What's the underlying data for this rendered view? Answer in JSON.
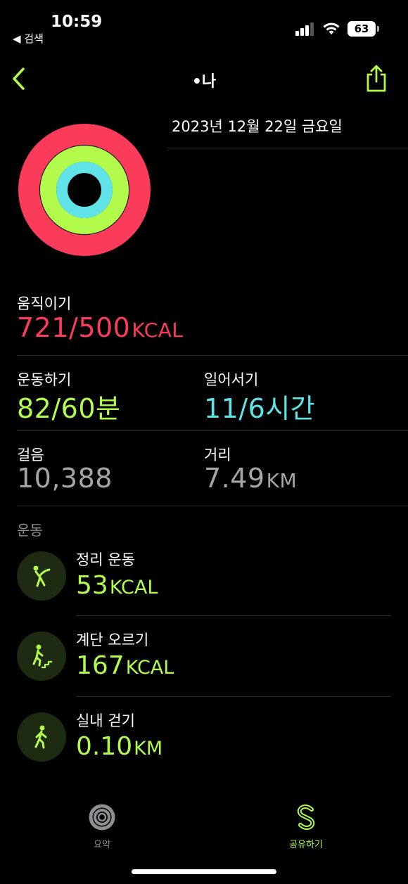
{
  "status_bar": {
    "time": "10:59",
    "back_app": "◀ 검색",
    "battery": "63"
  },
  "nav": {
    "title": "•나"
  },
  "summary": {
    "date": "2023년 12월 22일 금요일"
  },
  "rings": {
    "move_progress": 1.44,
    "exercise_progress": 1.37,
    "stand_progress": 1.83
  },
  "metrics": {
    "move": {
      "label": "움직이기",
      "value": "721/500",
      "unit": "KCAL"
    },
    "exercise": {
      "label": "운동하기",
      "value": "82/60분"
    },
    "stand": {
      "label": "일어서기",
      "value": "11/6시간"
    },
    "steps": {
      "label": "걸음",
      "value": "10,388"
    },
    "distance": {
      "label": "거리",
      "value": "7.49",
      "unit": "KM"
    }
  },
  "workouts_section": {
    "title": "운동"
  },
  "workouts": [
    {
      "name": "정리 운동",
      "value": "53",
      "unit": "KCAL",
      "icon": "cooldown-icon"
    },
    {
      "name": "계단 오르기",
      "value": "167",
      "unit": "KCAL",
      "icon": "stair-climbing-icon"
    },
    {
      "name": "실내 걷기",
      "value": "0.10",
      "unit": "KM",
      "icon": "walking-icon"
    }
  ],
  "tabs": [
    {
      "label": "요약",
      "icon": "summary-rings-icon",
      "active": false
    },
    {
      "label": "공유하기",
      "icon": "sharing-icon",
      "active": true
    }
  ],
  "colors": {
    "accent": "#b2fb4c",
    "move": "#fa3c5a",
    "exercise": "#b2fb4c",
    "stand": "#5fe3e6",
    "background": "#000000"
  }
}
